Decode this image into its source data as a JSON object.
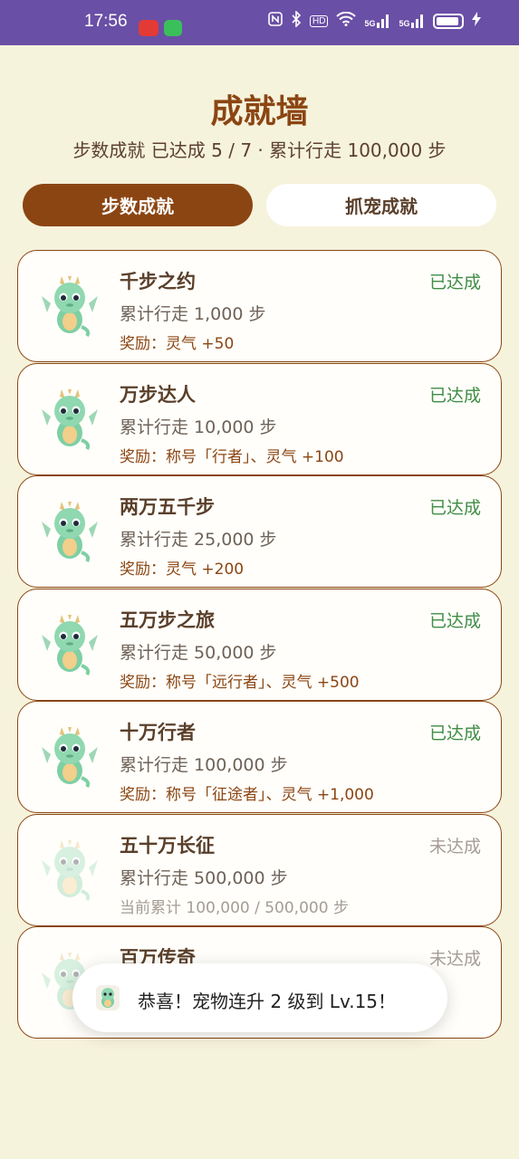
{
  "status_bar": {
    "time": "17:56",
    "icons": [
      "nfc-icon",
      "bluetooth-icon",
      "hd-icon",
      "wifi-icon",
      "signal-5g-icon",
      "signal-5g-icon",
      "battery-icon",
      "charging-icon"
    ],
    "hd_label": "HD",
    "net1": "5G",
    "net2": "5G"
  },
  "header": {
    "title": "成就墙",
    "subtitle": "步数成就 已达成 5 / 7 · 累计行走 100,000 步"
  },
  "tabs": [
    {
      "label": "步数成就",
      "active": true
    },
    {
      "label": "抓宠成就",
      "active": false
    }
  ],
  "achievements": [
    {
      "name": "千步之约",
      "desc": "累计行走 1,000 步",
      "reward": "奖励：灵气 +50",
      "status": "已达成"
    },
    {
      "name": "万步达人",
      "desc": "累计行走 10,000 步",
      "reward": "奖励：称号「行者」、灵气 +100",
      "status": "已达成"
    },
    {
      "name": "两万五千步",
      "desc": "累计行走 25,000 步",
      "reward": "奖励：灵气 +200",
      "status": "已达成"
    },
    {
      "name": "五万步之旅",
      "desc": "累计行走 50,000 步",
      "reward": "奖励：称号「远行者」、灵气 +500",
      "status": "已达成"
    },
    {
      "name": "十万行者",
      "desc": "累计行走 100,000 步",
      "reward": "奖励：称号「征途者」、灵气 +1,000",
      "status": "已达成"
    },
    {
      "name": "五十万长征",
      "desc": "累计行走 500,000 步",
      "reward": "当前累计 100,000 / 500,000 步",
      "status": "未达成"
    },
    {
      "name": "百万传奇",
      "desc": "",
      "reward": "",
      "status": "未达成"
    }
  ],
  "toast": {
    "icon": "dragon-icon",
    "text": "恭喜！宠物连升 2 级到 Lv.15！"
  },
  "colors": {
    "status_bar": "#6a4fa6",
    "background": "#f6f3dc",
    "accent_brown": "#8b4513",
    "done_green": "#3f8c45",
    "todo_gray": "#a59c94"
  }
}
